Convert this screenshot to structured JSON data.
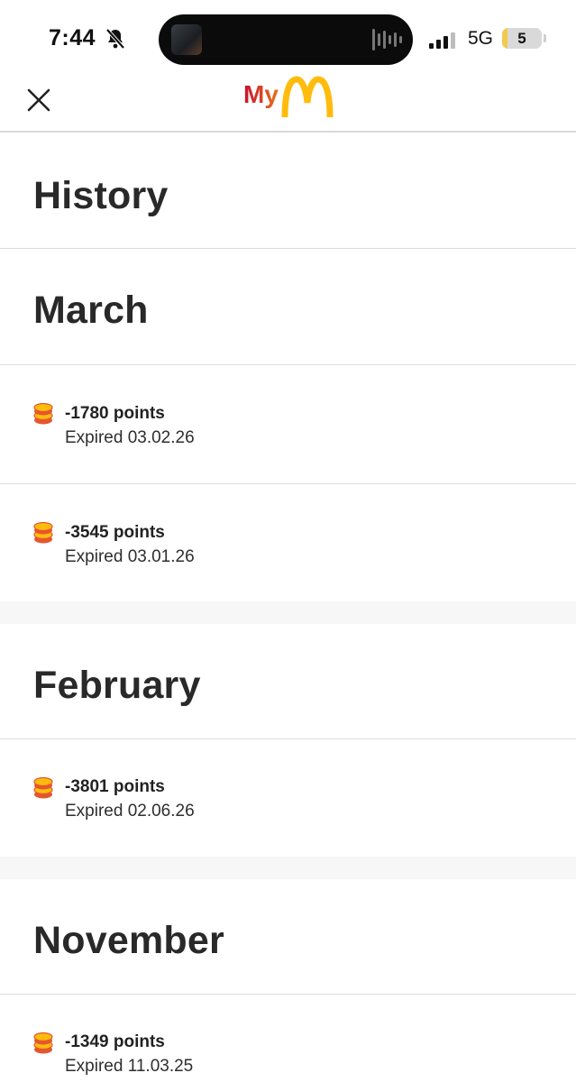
{
  "status_bar": {
    "time": "7:44",
    "network": "5G",
    "battery_level": "5",
    "battery_fraction": 0.05
  },
  "header": {
    "logo_text": "My",
    "close_icon": "close-icon",
    "brand_colors": {
      "my_gradient_start": "#c8102e",
      "my_gradient_end": "#ffbc0d",
      "arches": "#ffbc0d"
    }
  },
  "page": {
    "title": "History"
  },
  "groups": [
    {
      "month": "March",
      "entries": [
        {
          "points": "-1780 points",
          "detail": "Expired 03.02.26"
        },
        {
          "points": "-3545 points",
          "detail": "Expired 03.01.26"
        }
      ]
    },
    {
      "month": "February",
      "entries": [
        {
          "points": "-3801 points",
          "detail": "Expired 02.06.26"
        }
      ]
    },
    {
      "month": "November",
      "entries": [
        {
          "points": "-1349 points",
          "detail": "Expired 11.03.25"
        }
      ]
    }
  ]
}
